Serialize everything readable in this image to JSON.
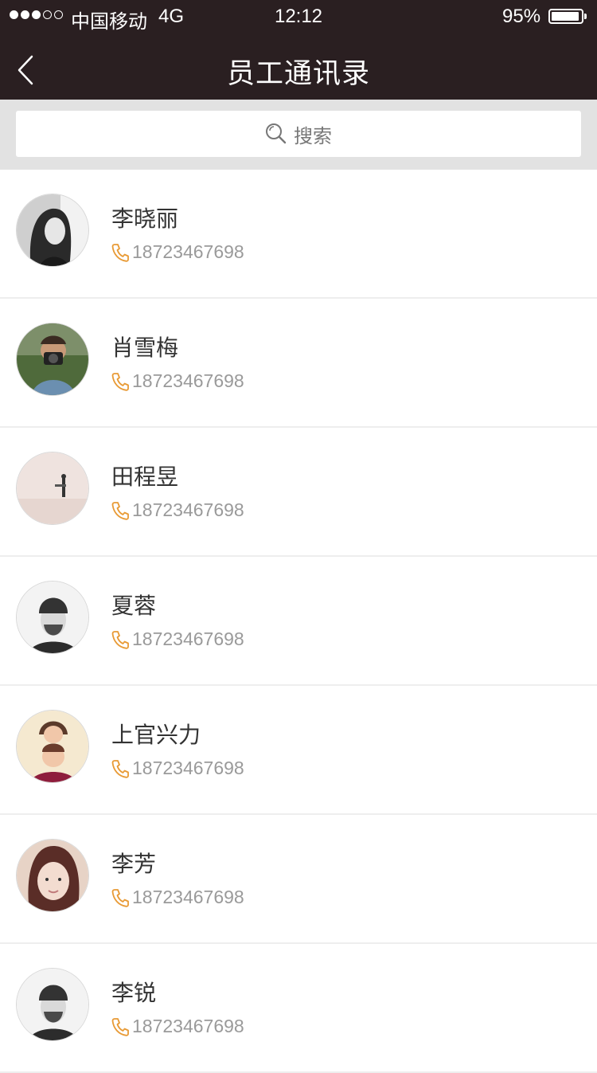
{
  "status_bar": {
    "carrier": "中国移动",
    "network": "4G",
    "time": "12:12",
    "battery": "95%"
  },
  "header": {
    "title": "员工通讯录",
    "back_icon": "chevron-left-icon"
  },
  "search": {
    "placeholder": "搜索",
    "icon": "search-icon"
  },
  "colors": {
    "header_bg": "#2a1f21",
    "phone_icon": "#e89a35",
    "search_bg": "#e2e2e2"
  },
  "contacts": [
    {
      "name": "李晓丽",
      "phone": "18723467698"
    },
    {
      "name": "肖雪梅",
      "phone": "18723467698"
    },
    {
      "name": "田程昱",
      "phone": "18723467698"
    },
    {
      "name": "夏蓉",
      "phone": "18723467698"
    },
    {
      "name": "上官兴力",
      "phone": "18723467698"
    },
    {
      "name": "李芳",
      "phone": "18723467698"
    },
    {
      "name": "李锐",
      "phone": "18723467698"
    }
  ]
}
